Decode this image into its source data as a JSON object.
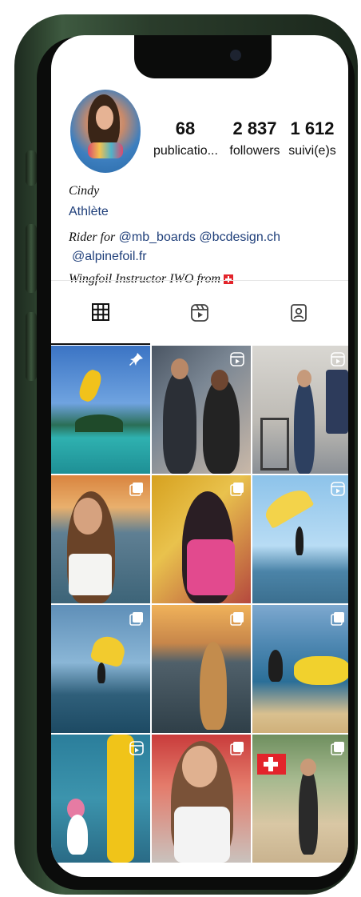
{
  "profile": {
    "name": "Cindy",
    "category": "Athlète",
    "bio_line1_prefix": "Rider for",
    "bio_mention1": "@mb_boards",
    "bio_mention2": "@bcdesign.ch",
    "bio_mention3": "@alpinefoil.fr",
    "bio_line3": "Wingfoil Instructor IWO from"
  },
  "stats": [
    {
      "value": "68",
      "label": "publicatio..."
    },
    {
      "value": "2 837",
      "label": "followers"
    },
    {
      "value": "1 612",
      "label": "suivi(e)s"
    }
  ],
  "tabs": [
    {
      "icon": "grid-icon",
      "active": true
    },
    {
      "icon": "reels-icon",
      "active": false
    },
    {
      "icon": "tagged-icon",
      "active": false
    }
  ],
  "posts": [
    {
      "scene": "kite over tropical lagoon",
      "badge": "pin-icon"
    },
    {
      "scene": "two riders in wetsuits",
      "badge": "reel-icon"
    },
    {
      "scene": "woman with foil boards indoors",
      "badge": "reel-icon"
    },
    {
      "scene": "smiling woman at sunset",
      "badge": "carousel-icon"
    },
    {
      "scene": "rider in pink jersey",
      "badge": "carousel-icon"
    },
    {
      "scene": "wingfoil jump",
      "badge": "reel-icon"
    },
    {
      "scene": "yellow wing in sky",
      "badge": "carousel-icon"
    },
    {
      "scene": "woman on water at sunset",
      "badge": "carousel-icon"
    },
    {
      "scene": "rider with yellow inflatable",
      "badge": "carousel-icon"
    },
    {
      "scene": "rider climbing yellow wing",
      "badge": "reel-icon"
    },
    {
      "scene": "woman smiling in jersey",
      "badge": "carousel-icon"
    },
    {
      "scene": "woman with swiss flag on beach",
      "badge": "carousel-icon"
    }
  ],
  "colors": {
    "accent_link": "#1f3f7a",
    "phone_green": "#3e5a40",
    "flag_red": "#e3242b"
  }
}
